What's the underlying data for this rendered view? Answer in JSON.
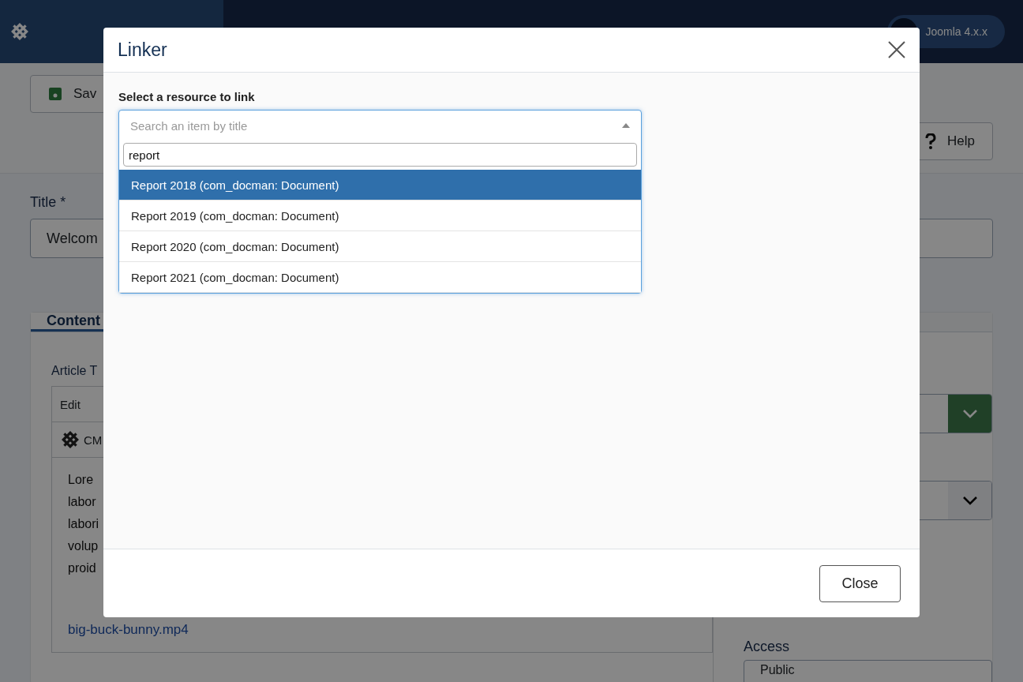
{
  "header": {
    "badge": "Joomla 4.x.x"
  },
  "toolbar": {
    "save": "Sav",
    "help": "Help"
  },
  "form": {
    "title_label": "Title *",
    "title_value": "Welcom"
  },
  "tabs": [
    {
      "label": "Content",
      "selected": true
    }
  ],
  "editor": {
    "label": "Article T",
    "menu": "Edit",
    "plugin": "CM",
    "lines": [
      "Lore",
      "labor",
      "labori",
      "volup",
      "proid"
    ],
    "link": "big-buck-bunny.mp4"
  },
  "sidebar": {
    "access_label": "Access",
    "access_value": "Public"
  },
  "modal": {
    "title": "Linker",
    "field_label": "Select a resource to link",
    "select_placeholder": "Search an item by title",
    "search_value": "report",
    "options": [
      {
        "label": "Report 2018 (com_docman: Document)",
        "selected": true
      },
      {
        "label": "Report 2019 (com_docman: Document)",
        "selected": false
      },
      {
        "label": "Report 2020 (com_docman: Document)",
        "selected": false
      },
      {
        "label": "Report 2021 (com_docman: Document)",
        "selected": false
      }
    ],
    "close_button": "Close"
  }
}
